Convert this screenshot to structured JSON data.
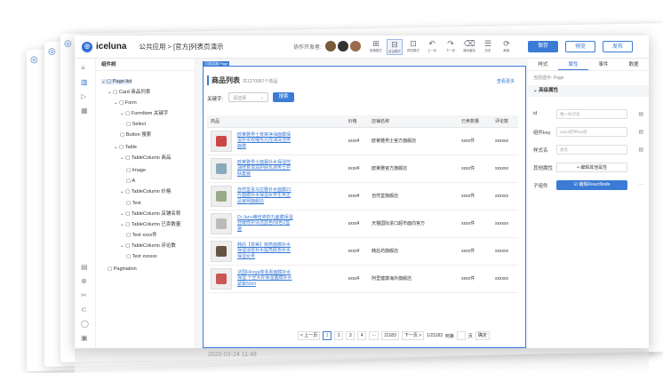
{
  "app": {
    "name": "iceluna",
    "breadcrumb": "公共应用 > [官方]列表页演示",
    "collaborators_label": "协作开发者:"
  },
  "toolbar": [
    {
      "label": "拖拽模式",
      "glyph": "⊞",
      "active": false
    },
    {
      "label": "自由模式",
      "glyph": "⊟",
      "active": true
    },
    {
      "label": "预览模式",
      "glyph": "⊡",
      "active": false
    },
    {
      "label": "上一步",
      "glyph": "↶",
      "active": false
    },
    {
      "label": "下一步",
      "glyph": "↷",
      "active": false
    },
    {
      "label": "清除缓存",
      "glyph": "⌫",
      "active": false
    },
    {
      "label": "历史",
      "glyph": "☰",
      "active": false
    },
    {
      "label": "刷新",
      "glyph": "⟳",
      "active": false
    }
  ],
  "actions": {
    "save": "保存",
    "preview": "预览",
    "publish": "发布"
  },
  "tree": {
    "header": "组件树",
    "nodes": [
      "Page-list",
      "Card 商品列表",
      "Form",
      "FormItem 关键字",
      "Select",
      "Button 搜索",
      "Table",
      "TableColumn 商品",
      "Image",
      "A",
      "TableColumn 价格",
      "Text",
      "TableColumn 店铺名称",
      "TableColumn 已卖数量",
      "Text xxxx件",
      "TableColumn 评论数",
      "Text xxxxxx",
      "Pagination"
    ]
  },
  "canvas": {
    "page_tag": "页面容器 Page",
    "title": "商品列表",
    "count": "共1270957个商品",
    "more": "查看更多",
    "keyword_label": "关键字:",
    "select_placeholder": "请选择",
    "search": "搜索",
    "columns": [
      "商品",
      "价格",
      "店铺名称",
      "已卖数量",
      "评论数"
    ],
    "rows": [
      {
        "name": "欧莱雅男士炭爽净油面膜保湿补水收缩毛孔控油清洁男面膜",
        "price": "xxxx¥",
        "shop": "欧莱雅男士官方旗舰店",
        "sold": "xxxx件",
        "reviews": "xxxxxx",
        "color": "#c44"
      },
      {
        "name": "欧莱雅男士面霜补水保湿控油修复滋润护肤乳液男士护肤套装",
        "price": "xxxx¥",
        "shop": "欧莱雅官方旗舰店",
        "sold": "xxxx件",
        "reviews": "xxxxxx",
        "color": "#8ab"
      },
      {
        "name": "自然堂喜马拉雅补水面膜21片面膜补水保湿女学生男正品官网旗舰店",
        "price": "xxxx¥",
        "shop": "自然堂旗舰店",
        "sold": "xxxx件",
        "reviews": "xxxxxx",
        "color": "#9a8"
      },
      {
        "name": "Dr.Jart+蒂佳婷药丸面膜保湿舒缓修护清洁蓝色/绿色2盒装",
        "price": "xxxx¥",
        "shop": "天猫国际进口超市面向官方",
        "sold": "xxxx件",
        "reviews": "xxxxxx",
        "color": "#bbb"
      },
      {
        "name": "韩后【变美】雨燕面膜补水保湿淡斑补水提亮肤色补水保湿女男",
        "price": "xxxx¥",
        "shop": "韩后坊旗舰店",
        "sold": "xxxx件",
        "reviews": "xxxxxx",
        "color": "#654"
      },
      {
        "name": "法国Filorga菲洛嘉面膜补水保湿 十全大补保湿面膜补水紧致50ml",
        "price": "xxxx¥",
        "shop": "阿里健康海外旗舰店",
        "sold": "xxxx件",
        "reviews": "xxxxxx",
        "color": "#c55"
      }
    ],
    "pager": {
      "prev": "< 上一页",
      "pages": [
        "1",
        "2",
        "3",
        "4",
        "···",
        "21183"
      ],
      "next": "下一页 >",
      "info": "1/21183",
      "goto": "到第",
      "unit": "页",
      "ok": "确定"
    }
  },
  "panel": {
    "tabs": [
      "样式",
      "属性",
      "事件",
      "数据"
    ],
    "current": "当前选中: Page",
    "section": "高级属性",
    "fields": [
      {
        "label": "id",
        "placeholder": "唯一标识名"
      },
      {
        "label": "组件key",
        "placeholder": "react组件key值"
      },
      {
        "label": "样式名",
        "placeholder": "类名"
      }
    ],
    "other_label": "其他属性",
    "add_other": "+ 编辑其他属性",
    "child_label": "子组件",
    "edit_node": "☑ 编辑ReactNode"
  },
  "reflection": {
    "timestamp": "2020-03-24 11:48"
  }
}
